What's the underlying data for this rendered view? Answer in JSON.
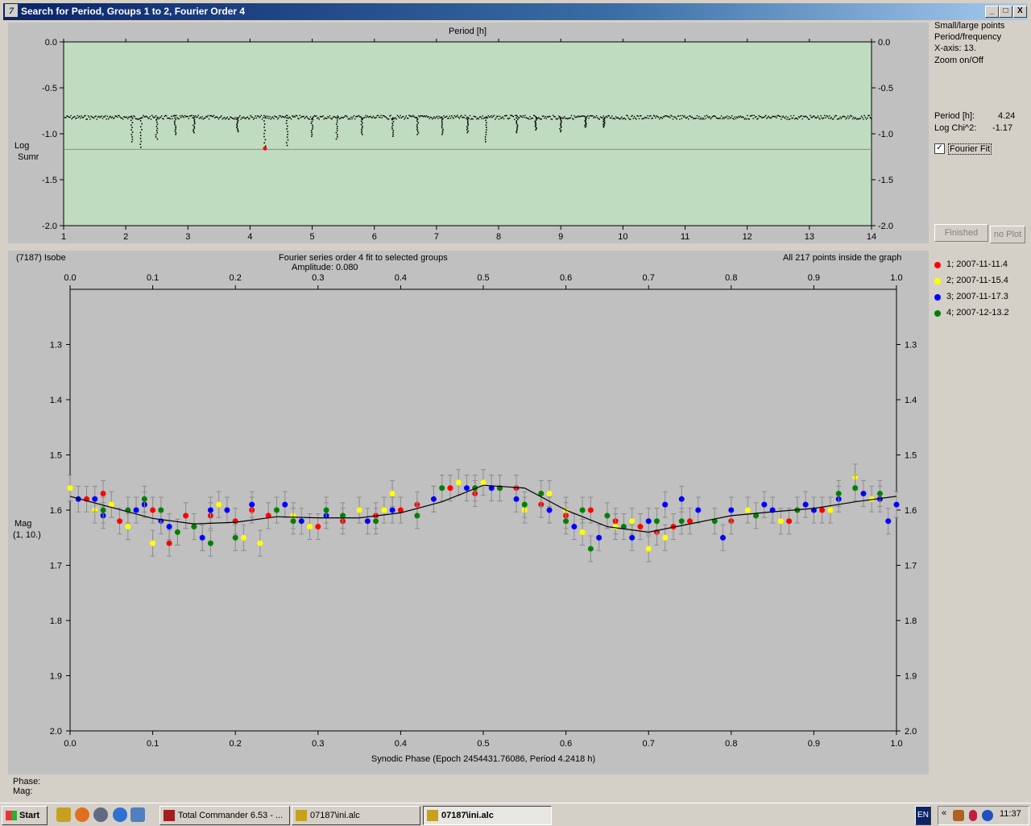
{
  "window": {
    "title": "Search for Period, Groups 1 to 2, Fourier Order 4",
    "app_icon": "7",
    "min_label": "_",
    "max_label": "□",
    "close_label": "X"
  },
  "right_panel": {
    "options": [
      "Small/large points",
      "Period/frequency",
      "X-axis: 13.",
      "Zoom on/Off"
    ],
    "period_label": "Period [h]:",
    "period_value": "4.24",
    "chi_label": "Log Chi^2:",
    "chi_value": "-1.17",
    "fourier_fit_label": "Fourier Fit",
    "fourier_fit_checked": true,
    "finished_label": "Finished",
    "no_plot_label": "no Plot"
  },
  "bottom_header": {
    "object": "(7187) Isobe",
    "fit_title": "Fourier series order 4 fit to selected groups",
    "amplitude": "Amplitude: 0.080",
    "points": "All 217 points inside the graph"
  },
  "legend": [
    {
      "label": "1; 2007-11-11.4",
      "color": "#ff0000"
    },
    {
      "label": "2; 2007-11-15.4",
      "color": "#ffff00"
    },
    {
      "label": "3; 2007-11-17.3",
      "color": "#0000ff"
    },
    {
      "label": "4; 2007-12-13.2",
      "color": "#008000"
    }
  ],
  "status": {
    "phase": "Phase:",
    "mag": "Mag:"
  },
  "taskbar": {
    "start": "Start",
    "items": [
      "Total Commander 6.53 - ...",
      "07187\\ini.alc",
      "07187\\ini.alc"
    ],
    "lang": "EN",
    "clock": "11:37"
  },
  "chart_data": [
    {
      "type": "scatter",
      "title": "Period [h]",
      "ylabel": "Log Sumr",
      "xlim": [
        1,
        14
      ],
      "ylim": [
        -2.0,
        0.0
      ],
      "xticks": [
        "1",
        "2",
        "3",
        "4",
        "5",
        "6",
        "7",
        "8",
        "9",
        "10",
        "11",
        "12",
        "13",
        "14"
      ],
      "yticks": [
        "0.0",
        "-0.5",
        "-1.0",
        "-1.5",
        "-2.0"
      ],
      "baseline": -0.82,
      "threshold_line": -1.17,
      "dips": [
        [
          2.25,
          -1.14
        ],
        [
          2.1,
          -1.08
        ],
        [
          2.5,
          -1.05
        ],
        [
          2.8,
          -1.0
        ],
        [
          3.1,
          -0.98
        ],
        [
          3.8,
          -0.97
        ],
        [
          4.24,
          -1.16
        ],
        [
          4.6,
          -1.12
        ],
        [
          5.0,
          -1.02
        ],
        [
          5.4,
          -1.05
        ],
        [
          5.8,
          -1.0
        ],
        [
          6.3,
          -1.02
        ],
        [
          6.7,
          -1.0
        ],
        [
          7.1,
          -1.0
        ],
        [
          7.5,
          -0.98
        ],
        [
          7.8,
          -1.08
        ],
        [
          8.3,
          -0.98
        ],
        [
          8.6,
          -0.95
        ],
        [
          9.0,
          -0.97
        ],
        [
          9.4,
          -0.92
        ],
        [
          9.7,
          -0.92
        ]
      ],
      "best_period": 4.24,
      "best_value": -1.16
    },
    {
      "type": "scatter",
      "title": "Fourier series order 4 fit to selected groups",
      "xlabel": "Synodic Phase (Epoch 2454431.76086, Period 4.2418 h)",
      "ylabel": "Mag (1, 10.)",
      "xlim": [
        0.0,
        1.0
      ],
      "ylim": [
        1.2,
        2.0
      ],
      "y_inverted": true,
      "xticks": [
        "0.0",
        "0.1",
        "0.2",
        "0.3",
        "0.4",
        "0.5",
        "0.6",
        "0.7",
        "0.8",
        "0.9",
        "1.0"
      ],
      "yticks": [
        "1.3",
        "1.4",
        "1.5",
        "1.6",
        "1.7",
        "1.8",
        "1.9",
        "2.0"
      ],
      "fit_curve": {
        "phase": [
          0.0,
          0.05,
          0.1,
          0.15,
          0.2,
          0.25,
          0.3,
          0.35,
          0.4,
          0.45,
          0.5,
          0.55,
          0.6,
          0.65,
          0.7,
          0.75,
          0.8,
          0.85,
          0.9,
          0.95,
          1.0
        ],
        "mag": [
          1.575,
          1.595,
          1.615,
          1.625,
          1.622,
          1.612,
          1.614,
          1.614,
          1.605,
          1.585,
          1.555,
          1.56,
          1.6,
          1.63,
          1.64,
          1.625,
          1.61,
          1.603,
          1.597,
          1.585,
          1.575
        ]
      },
      "series": [
        {
          "name": "1; 2007-11-11.4",
          "color": "#ff0000",
          "points": [
            [
              0.02,
              1.58
            ],
            [
              0.04,
              1.57
            ],
            [
              0.06,
              1.62
            ],
            [
              0.1,
              1.6
            ],
            [
              0.12,
              1.66
            ],
            [
              0.14,
              1.61
            ],
            [
              0.17,
              1.61
            ],
            [
              0.2,
              1.62
            ],
            [
              0.22,
              1.6
            ],
            [
              0.24,
              1.61
            ],
            [
              0.3,
              1.63
            ],
            [
              0.33,
              1.62
            ],
            [
              0.37,
              1.61
            ],
            [
              0.4,
              1.6
            ],
            [
              0.42,
              1.59
            ],
            [
              0.46,
              1.56
            ],
            [
              0.49,
              1.57
            ],
            [
              0.52,
              1.56
            ],
            [
              0.54,
              1.56
            ],
            [
              0.57,
              1.59
            ],
            [
              0.6,
              1.61
            ],
            [
              0.63,
              1.6
            ],
            [
              0.66,
              1.62
            ],
            [
              0.69,
              1.63
            ],
            [
              0.71,
              1.64
            ],
            [
              0.73,
              1.63
            ],
            [
              0.75,
              1.62
            ],
            [
              0.8,
              1.62
            ],
            [
              0.87,
              1.62
            ],
            [
              0.91,
              1.6
            ]
          ]
        },
        {
          "name": "2; 2007-11-15.4",
          "color": "#ffff00",
          "points": [
            [
              0.0,
              1.56
            ],
            [
              0.03,
              1.6
            ],
            [
              0.05,
              1.59
            ],
            [
              0.07,
              1.63
            ],
            [
              0.1,
              1.66
            ],
            [
              0.13,
              1.64
            ],
            [
              0.16,
              1.65
            ],
            [
              0.18,
              1.59
            ],
            [
              0.21,
              1.65
            ],
            [
              0.23,
              1.66
            ],
            [
              0.27,
              1.61
            ],
            [
              0.29,
              1.63
            ],
            [
              0.35,
              1.6
            ],
            [
              0.38,
              1.6
            ],
            [
              0.39,
              1.57
            ],
            [
              0.44,
              1.58
            ],
            [
              0.47,
              1.55
            ],
            [
              0.5,
              1.55
            ],
            [
              0.55,
              1.6
            ],
            [
              0.58,
              1.57
            ],
            [
              0.6,
              1.6
            ],
            [
              0.62,
              1.64
            ],
            [
              0.66,
              1.63
            ],
            [
              0.68,
              1.62
            ],
            [
              0.7,
              1.67
            ],
            [
              0.72,
              1.65
            ],
            [
              0.82,
              1.6
            ],
            [
              0.86,
              1.62
            ],
            [
              0.92,
              1.6
            ],
            [
              0.95,
              1.54
            ],
            [
              0.97,
              1.58
            ]
          ]
        },
        {
          "name": "3; 2007-11-17.3",
          "color": "#0000ff",
          "points": [
            [
              0.01,
              1.58
            ],
            [
              0.03,
              1.58
            ],
            [
              0.04,
              1.61
            ],
            [
              0.08,
              1.6
            ],
            [
              0.09,
              1.59
            ],
            [
              0.11,
              1.62
            ],
            [
              0.12,
              1.63
            ],
            [
              0.16,
              1.65
            ],
            [
              0.17,
              1.6
            ],
            [
              0.19,
              1.6
            ],
            [
              0.22,
              1.59
            ],
            [
              0.26,
              1.59
            ],
            [
              0.28,
              1.62
            ],
            [
              0.31,
              1.61
            ],
            [
              0.36,
              1.62
            ],
            [
              0.39,
              1.6
            ],
            [
              0.44,
              1.58
            ],
            [
              0.48,
              1.56
            ],
            [
              0.51,
              1.56
            ],
            [
              0.54,
              1.58
            ],
            [
              0.58,
              1.6
            ],
            [
              0.61,
              1.63
            ],
            [
              0.64,
              1.65
            ],
            [
              0.68,
              1.65
            ],
            [
              0.7,
              1.62
            ],
            [
              0.72,
              1.59
            ],
            [
              0.74,
              1.58
            ],
            [
              0.76,
              1.6
            ],
            [
              0.79,
              1.65
            ],
            [
              0.8,
              1.6
            ],
            [
              0.84,
              1.59
            ],
            [
              0.85,
              1.6
            ],
            [
              0.89,
              1.59
            ],
            [
              0.9,
              1.6
            ],
            [
              0.93,
              1.58
            ],
            [
              0.96,
              1.57
            ],
            [
              0.98,
              1.58
            ],
            [
              0.99,
              1.62
            ],
            [
              1.0,
              1.59
            ]
          ]
        },
        {
          "name": "4; 2007-12-13.2",
          "color": "#008000",
          "points": [
            [
              0.04,
              1.6
            ],
            [
              0.07,
              1.6
            ],
            [
              0.09,
              1.58
            ],
            [
              0.11,
              1.6
            ],
            [
              0.13,
              1.64
            ],
            [
              0.15,
              1.63
            ],
            [
              0.17,
              1.66
            ],
            [
              0.2,
              1.65
            ],
            [
              0.25,
              1.6
            ],
            [
              0.27,
              1.62
            ],
            [
              0.31,
              1.6
            ],
            [
              0.33,
              1.61
            ],
            [
              0.37,
              1.62
            ],
            [
              0.42,
              1.61
            ],
            [
              0.45,
              1.56
            ],
            [
              0.49,
              1.56
            ],
            [
              0.52,
              1.56
            ],
            [
              0.55,
              1.59
            ],
            [
              0.57,
              1.57
            ],
            [
              0.6,
              1.62
            ],
            [
              0.62,
              1.6
            ],
            [
              0.63,
              1.67
            ],
            [
              0.65,
              1.61
            ],
            [
              0.67,
              1.63
            ],
            [
              0.71,
              1.62
            ],
            [
              0.74,
              1.62
            ],
            [
              0.78,
              1.62
            ],
            [
              0.83,
              1.61
            ],
            [
              0.88,
              1.6
            ],
            [
              0.93,
              1.57
            ],
            [
              0.95,
              1.56
            ],
            [
              0.98,
              1.57
            ]
          ]
        }
      ]
    }
  ]
}
